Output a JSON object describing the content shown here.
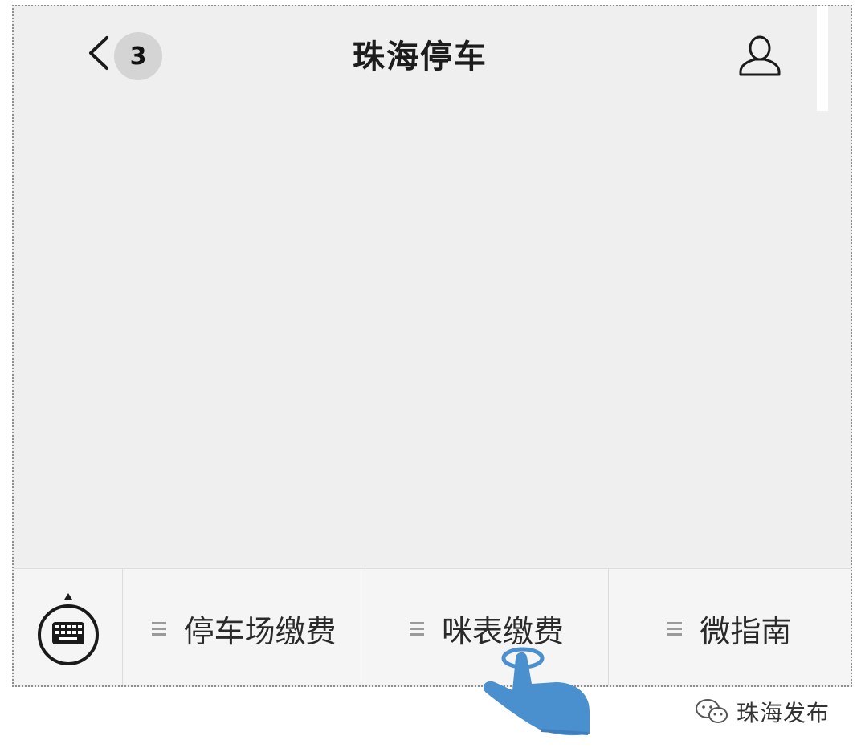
{
  "header": {
    "unread_count": "3",
    "title": "珠海停车",
    "back_icon": "chevron-left-icon",
    "profile_icon": "user-icon"
  },
  "menu": {
    "keyboard_icon": "keyboard-icon",
    "items": [
      {
        "label": "停车场缴费",
        "icon": "menu-lines-icon"
      },
      {
        "label": "咪表缴费",
        "icon": "menu-lines-icon"
      },
      {
        "label": "微指南",
        "icon": "menu-lines-icon"
      }
    ]
  },
  "overlay": {
    "pointer_icon": "hand-tap-icon",
    "pointer_target": "咪表缴费"
  },
  "watermark": {
    "icon": "wechat-icon",
    "text": "珠海发布"
  },
  "colors": {
    "background": "#efefef",
    "menubar": "#f5f5f5",
    "badge": "#d4d4d4",
    "hand": "#4a8fce"
  }
}
